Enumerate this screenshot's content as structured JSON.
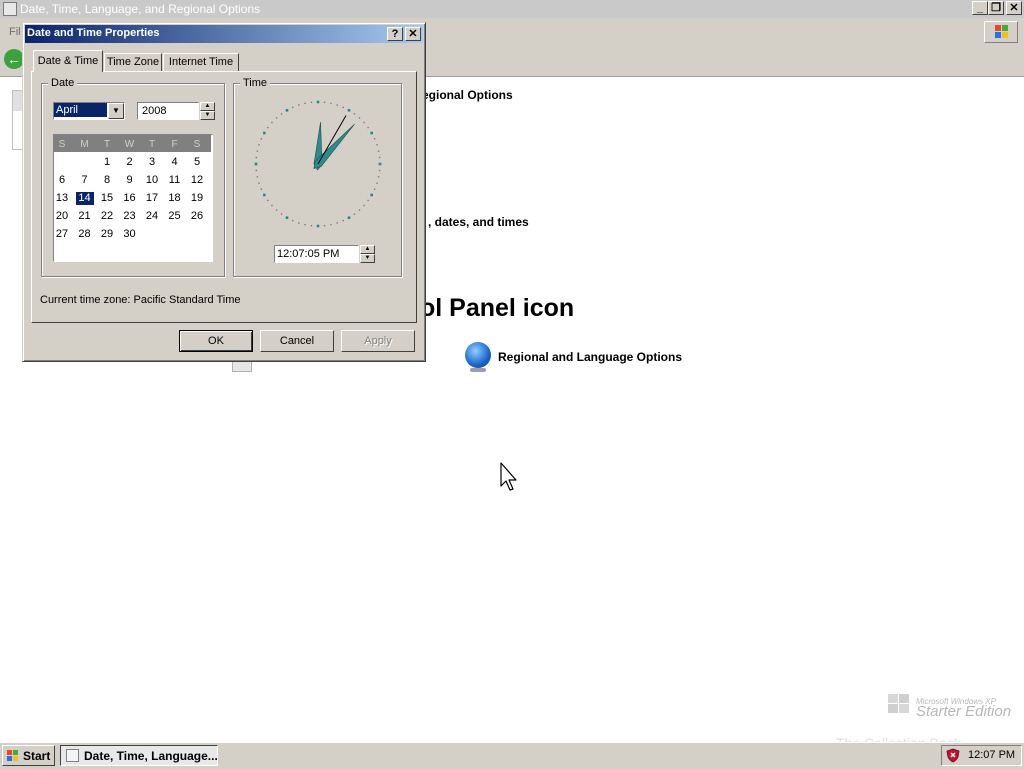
{
  "background_window": {
    "title": "Date, Time, Language, and Regional Options",
    "menu_file": "Fil",
    "text_regional": "egional Options",
    "text_dates": ", dates, and times",
    "heading": "ol Panel icon",
    "regional_language_label": "Regional and Language Options"
  },
  "watermark": {
    "small": "Microsoft Windows XP",
    "big": "Starter Edition",
    "collection": "The Collection Book"
  },
  "dialog": {
    "title": "Date and Time Properties",
    "help_glyph": "?",
    "close_glyph": "✕",
    "tabs": [
      {
        "label": "Date & Time",
        "active": true
      },
      {
        "label": "Time Zone",
        "active": false
      },
      {
        "label": "Internet Time",
        "active": false
      }
    ],
    "date_group_label": "Date",
    "time_group_label": "Time",
    "month": "April",
    "year": "2008",
    "weekdays": [
      "S",
      "M",
      "T",
      "W",
      "T",
      "F",
      "S"
    ],
    "calendar_rows": [
      [
        "",
        "",
        "1",
        "2",
        "3",
        "4",
        "5"
      ],
      [
        "6",
        "7",
        "8",
        "9",
        "10",
        "11",
        "12"
      ],
      [
        "13",
        "14",
        "15",
        "16",
        "17",
        "18",
        "19"
      ],
      [
        "20",
        "21",
        "22",
        "23",
        "24",
        "25",
        "26"
      ],
      [
        "27",
        "28",
        "29",
        "30",
        "",
        "",
        ""
      ]
    ],
    "selected_day": "14",
    "time_value": "12:07:05 PM",
    "clock": {
      "hour": 12,
      "minute": 7,
      "second": 5
    },
    "timezone_text": "Current time zone:  Pacific Standard Time",
    "buttons": {
      "ok": "OK",
      "cancel": "Cancel",
      "apply": "Apply"
    }
  },
  "taskbar": {
    "start_label": "Start",
    "task_label": "Date, Time, Language...",
    "tray_time": "12:07 PM"
  },
  "colors": {
    "title_active": "#0a246a",
    "selection": "#0a246a",
    "face": "#d4d0c8",
    "clock_hand": "#2e8b8b"
  }
}
